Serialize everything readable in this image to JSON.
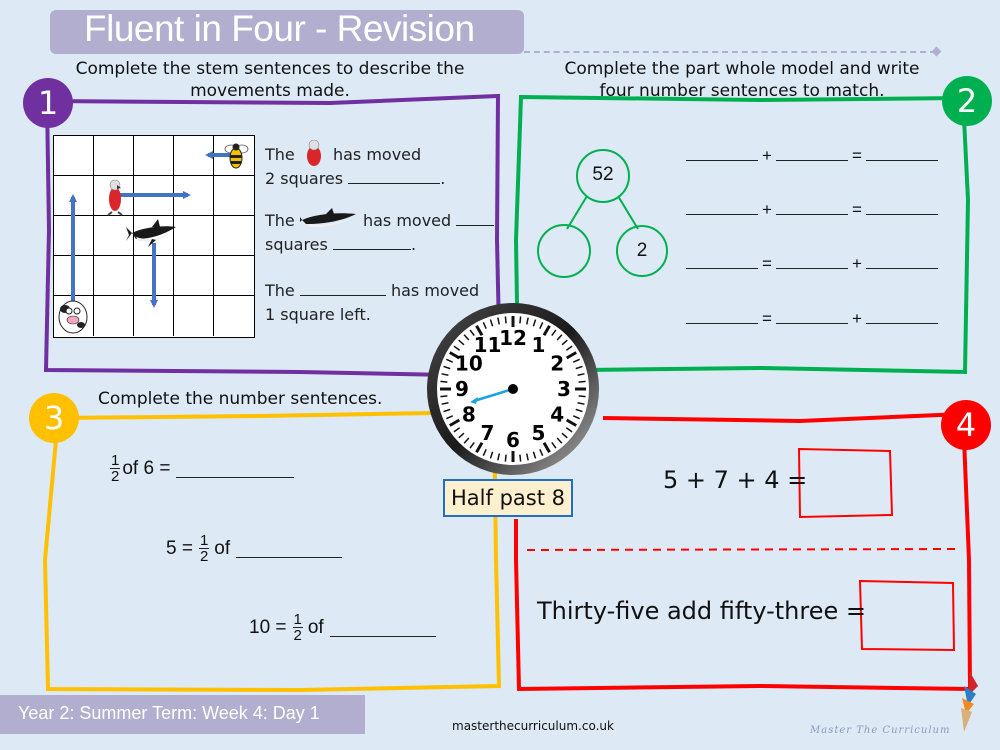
{
  "header": {
    "title": "Fluent in Four - Revision"
  },
  "questions": [
    {
      "number": "1",
      "color": "#7030a0",
      "instruction_line1": "Complete the stem sentences to describe the",
      "instruction_line2": "movements made.",
      "grid": {
        "rows": 5,
        "cols": 5
      },
      "animals": [
        {
          "name": "bee",
          "icon": "bee-icon"
        },
        {
          "name": "parrot",
          "icon": "parrot-icon"
        },
        {
          "name": "shark",
          "icon": "shark-icon"
        },
        {
          "name": "cow",
          "icon": "cow-icon"
        }
      ],
      "stems": [
        {
          "part1": "The",
          "part2": "has moved",
          "line2": "2 squares",
          "end": "."
        },
        {
          "part1": "The",
          "part2": "has moved",
          "line2": "squares",
          "end": "."
        },
        {
          "part1": "The",
          "part2": "has moved",
          "line2": "1 square left.",
          "end": ""
        }
      ]
    },
    {
      "number": "2",
      "color": "#00b050",
      "instruction_line1": "Complete the part whole model and write",
      "instruction_line2": "four number sentences to match.",
      "whole": "52",
      "part_a": "",
      "part_b": "2",
      "sentences": [
        {
          "op1": "+",
          "op2": "="
        },
        {
          "op1": "+",
          "op2": "="
        },
        {
          "op1": "=",
          "op2": "+"
        },
        {
          "op1": "=",
          "op2": "+"
        }
      ]
    },
    {
      "number": "3",
      "color": "#ffc000",
      "instruction": "Complete the number sentences.",
      "lines": [
        {
          "prefix": "",
          "num": "1",
          "den": "2",
          "middle": "of 6 ="
        },
        {
          "prefix": "5 =",
          "num": "1",
          "den": "2",
          "middle": "of"
        },
        {
          "prefix": "10 =",
          "num": "1",
          "den": "2",
          "middle": "of"
        }
      ]
    },
    {
      "number": "4",
      "color": "#ff0000",
      "line1": "5 + 7 + 4 =",
      "line2": "Thirty-five add fifty-three ="
    }
  ],
  "clock": {
    "label": "Half past 8",
    "numbers": [
      "12",
      "1",
      "2",
      "3",
      "4",
      "5",
      "6",
      "7",
      "8",
      "9",
      "10",
      "11"
    ],
    "hour_hand_color": "#1ca1e0"
  },
  "footer": {
    "term": "Year 2: Summer Term: Week 4: Day 1",
    "website": "masterthecurriculum.co.uk",
    "brand": "Master The Curriculum"
  }
}
